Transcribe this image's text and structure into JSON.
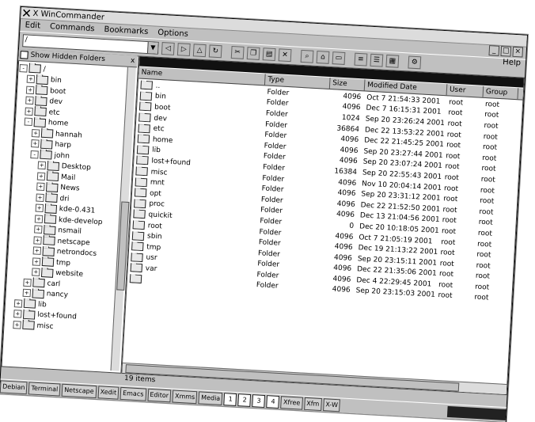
{
  "window": {
    "title": "X WinCommander"
  },
  "menu": {
    "items": [
      "Edit",
      "Commands",
      "Bookmarks",
      "Options"
    ],
    "help": "Help"
  },
  "toolbar": {
    "path_value": "/"
  },
  "left": {
    "show_hidden": "Show Hidden Folders",
    "close": "x",
    "tree": [
      {
        "label": "/",
        "depth": 0,
        "expander": "-"
      },
      {
        "label": "bin",
        "depth": 1,
        "expander": "+"
      },
      {
        "label": "boot",
        "depth": 1,
        "expander": "+"
      },
      {
        "label": "dev",
        "depth": 1,
        "expander": "+"
      },
      {
        "label": "etc",
        "depth": 1,
        "expander": "+"
      },
      {
        "label": "home",
        "depth": 1,
        "expander": "-"
      },
      {
        "label": "hannah",
        "depth": 2,
        "expander": "+"
      },
      {
        "label": "harp",
        "depth": 2,
        "expander": "+"
      },
      {
        "label": "john",
        "depth": 2,
        "expander": "-"
      },
      {
        "label": "Desktop",
        "depth": 3,
        "expander": "+"
      },
      {
        "label": "Mail",
        "depth": 3,
        "expander": "+"
      },
      {
        "label": "News",
        "depth": 3,
        "expander": "+"
      },
      {
        "label": "dri",
        "depth": 3,
        "expander": "+"
      },
      {
        "label": "kde-0.431",
        "depth": 3,
        "expander": "+"
      },
      {
        "label": "kde-develop",
        "depth": 3,
        "expander": "+"
      },
      {
        "label": "nsmail",
        "depth": 3,
        "expander": "+"
      },
      {
        "label": "netscape",
        "depth": 3,
        "expander": "+"
      },
      {
        "label": "netrondocs",
        "depth": 3,
        "expander": "+"
      },
      {
        "label": "tmp",
        "depth": 3,
        "expander": "+"
      },
      {
        "label": "website",
        "depth": 3,
        "expander": "+"
      },
      {
        "label": "carl",
        "depth": 2,
        "expander": "+"
      },
      {
        "label": "nancy",
        "depth": 2,
        "expander": "+"
      },
      {
        "label": "lib",
        "depth": 1,
        "expander": "+"
      },
      {
        "label": "lost+found",
        "depth": 1,
        "expander": "+"
      },
      {
        "label": "misc",
        "depth": 1,
        "expander": "+"
      }
    ]
  },
  "files": {
    "columns": [
      "Name",
      "Type",
      "Size",
      "Modified Date",
      "User",
      "Group"
    ],
    "rows": [
      {
        "name": "..",
        "type": "Folder",
        "size": "4096",
        "modified": "Oct 7 21:54:33 2001",
        "user": "root",
        "group": "root"
      },
      {
        "name": "bin",
        "type": "Folder",
        "size": "4096",
        "modified": "Dec 7 16:15:31 2001",
        "user": "root",
        "group": "root"
      },
      {
        "name": "boot",
        "type": "Folder",
        "size": "1024",
        "modified": "Sep 20 23:26:24 2001",
        "user": "root",
        "group": "root"
      },
      {
        "name": "dev",
        "type": "Folder",
        "size": "36864",
        "modified": "Dec 22 13:53:22 2001",
        "user": "root",
        "group": "root"
      },
      {
        "name": "etc",
        "type": "Folder",
        "size": "4096",
        "modified": "Dec 22 21:45:25 2001",
        "user": "root",
        "group": "root"
      },
      {
        "name": "home",
        "type": "Folder",
        "size": "4096",
        "modified": "Sep 20 23:27:44 2001",
        "user": "root",
        "group": "root"
      },
      {
        "name": "lib",
        "type": "Folder",
        "size": "4096",
        "modified": "Sep 20 23:07:24 2001",
        "user": "root",
        "group": "root"
      },
      {
        "name": "lost+found",
        "type": "Folder",
        "size": "16384",
        "modified": "Sep 20 22:55:43 2001",
        "user": "root",
        "group": "root"
      },
      {
        "name": "misc",
        "type": "Folder",
        "size": "4096",
        "modified": "Nov 10 20:04:14 2001",
        "user": "root",
        "group": "root"
      },
      {
        "name": "mnt",
        "type": "Folder",
        "size": "4096",
        "modified": "Sep 20 23:31:12 2001",
        "user": "root",
        "group": "root"
      },
      {
        "name": "opt",
        "type": "Folder",
        "size": "4096",
        "modified": "Dec 22 21:52:50 2001",
        "user": "root",
        "group": "root"
      },
      {
        "name": "proc",
        "type": "Folder",
        "size": "4096",
        "modified": "Dec 13 21:04:56 2001",
        "user": "root",
        "group": "root"
      },
      {
        "name": "quickit",
        "type": "Folder",
        "size": "0",
        "modified": "Dec 20 10:18:05 2001",
        "user": "root",
        "group": "root"
      },
      {
        "name": "root",
        "type": "Folder",
        "size": "4096",
        "modified": "Oct 7 21:05:19 2001",
        "user": "root",
        "group": "root"
      },
      {
        "name": "sbin",
        "type": "Folder",
        "size": "4096",
        "modified": "Dec 19 21:13:22 2001",
        "user": "root",
        "group": "root"
      },
      {
        "name": "tmp",
        "type": "Folder",
        "size": "4096",
        "modified": "Sep 20 23:15:11 2001",
        "user": "root",
        "group": "root"
      },
      {
        "name": "usr",
        "type": "Folder",
        "size": "4096",
        "modified": "Dec 22 21:35:06 2001",
        "user": "root",
        "group": "root"
      },
      {
        "name": "var",
        "type": "Folder",
        "size": "4096",
        "modified": "Dec 4 22:29:45 2001",
        "user": "root",
        "group": "root"
      },
      {
        "name": "",
        "type": "Folder",
        "size": "4096",
        "modified": "Sep 20 23:15:03 2001",
        "user": "root",
        "group": "root"
      }
    ]
  },
  "status": {
    "text": "19 items"
  },
  "taskbar": {
    "buttons": [
      "Debian",
      "Terminal",
      "Netscape",
      "Xedit",
      "Emacs",
      "Editor",
      "Xmms",
      "Media"
    ],
    "pages": [
      "1",
      "2",
      "3",
      "4"
    ],
    "windows": [
      "Xfree",
      "Xfm",
      "X-W"
    ]
  }
}
